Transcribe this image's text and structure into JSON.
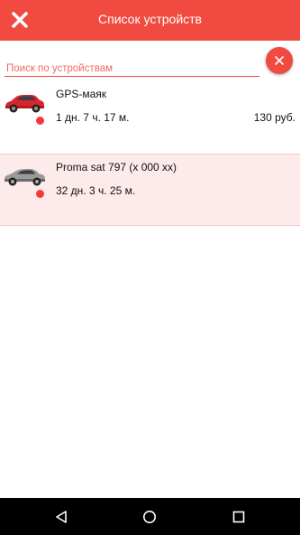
{
  "header": {
    "title": "Список устройств",
    "close_icon": "close-icon"
  },
  "search": {
    "placeholder": "Поиск по устройствам",
    "value": "",
    "clear_icon": "close-icon"
  },
  "devices": [
    {
      "name": "GPS-маяк",
      "duration": "1 дн. 7 ч. 17 м.",
      "price": "130 руб.",
      "image": "red-car",
      "status_color": "#f23a3a"
    },
    {
      "name": "Proma sat 797 (x 000 xx)",
      "duration": "32 дн. 3 ч. 25 м.",
      "price": "",
      "image": "silver-car",
      "status_color": "#f23a3a"
    }
  ],
  "colors": {
    "accent": "#f04a41",
    "selected_row": "#fdeaea"
  },
  "navbar": {
    "back_icon": "back-triangle-icon",
    "home_icon": "home-circle-icon",
    "recents_icon": "recents-square-icon"
  }
}
